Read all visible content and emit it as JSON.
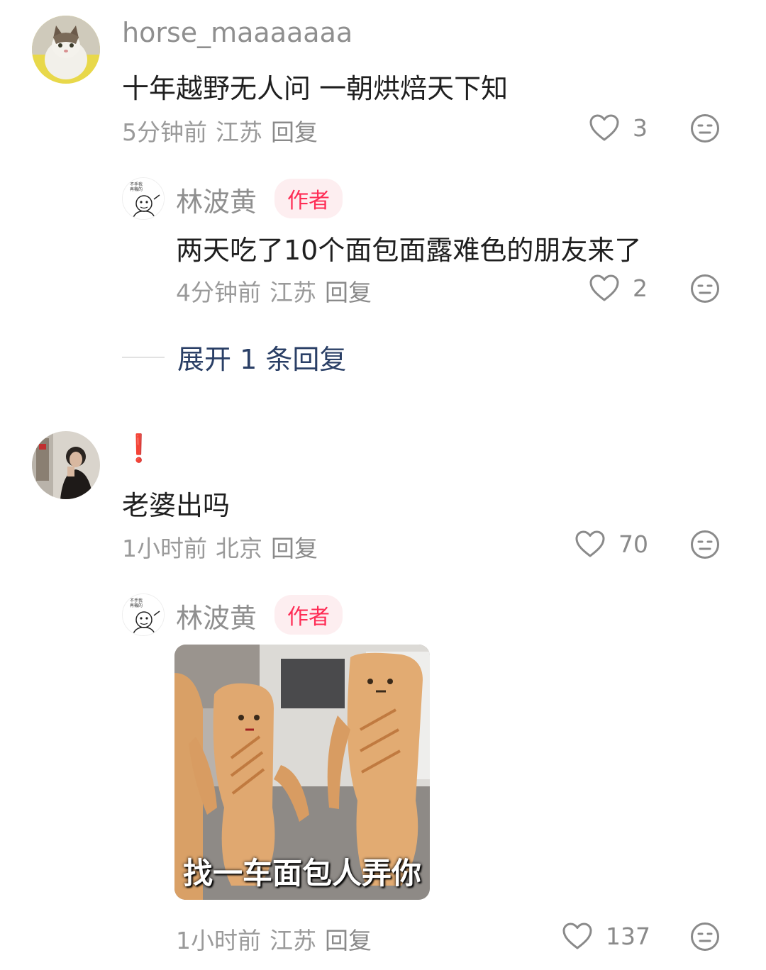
{
  "comments": [
    {
      "username": "horse_maaaaaaa",
      "text": "十年越野无人问 一朝烘焙天下知",
      "time": "5分钟前",
      "location": "江苏",
      "reply_label": "回复",
      "likes": "3",
      "avatar_icon": "cat-avatar-icon",
      "replies": [
        {
          "username": "林波黄",
          "badge": "作者",
          "text": "两天吃了10个面包面露难色的朋友来了",
          "time": "4分钟前",
          "location": "江苏",
          "reply_label": "回复",
          "likes": "2",
          "avatar_icon": "cartoon-avatar-icon"
        }
      ],
      "expand_label": "展开 1 条回复"
    },
    {
      "username": "❗",
      "text": "老婆出吗",
      "time": "1小时前",
      "location": "北京",
      "reply_label": "回复",
      "likes": "70",
      "avatar_icon": "woman-photo-avatar-icon",
      "replies": [
        {
          "username": "林波黄",
          "badge": "作者",
          "sticker_caption": "找一车面包人弄你",
          "time": "1小时前",
          "location": "江苏",
          "reply_label": "回复",
          "likes": "137",
          "avatar_icon": "cartoon-avatar-icon"
        }
      ]
    }
  ],
  "icons": {
    "like": "heart-outline-icon",
    "dislike": "neutral-face-icon"
  },
  "colors": {
    "author_badge_text": "#fe2c55",
    "author_badge_bg": "#fdeef0",
    "expand_link": "#2a3f66",
    "meta_text": "#9a9a9a"
  }
}
